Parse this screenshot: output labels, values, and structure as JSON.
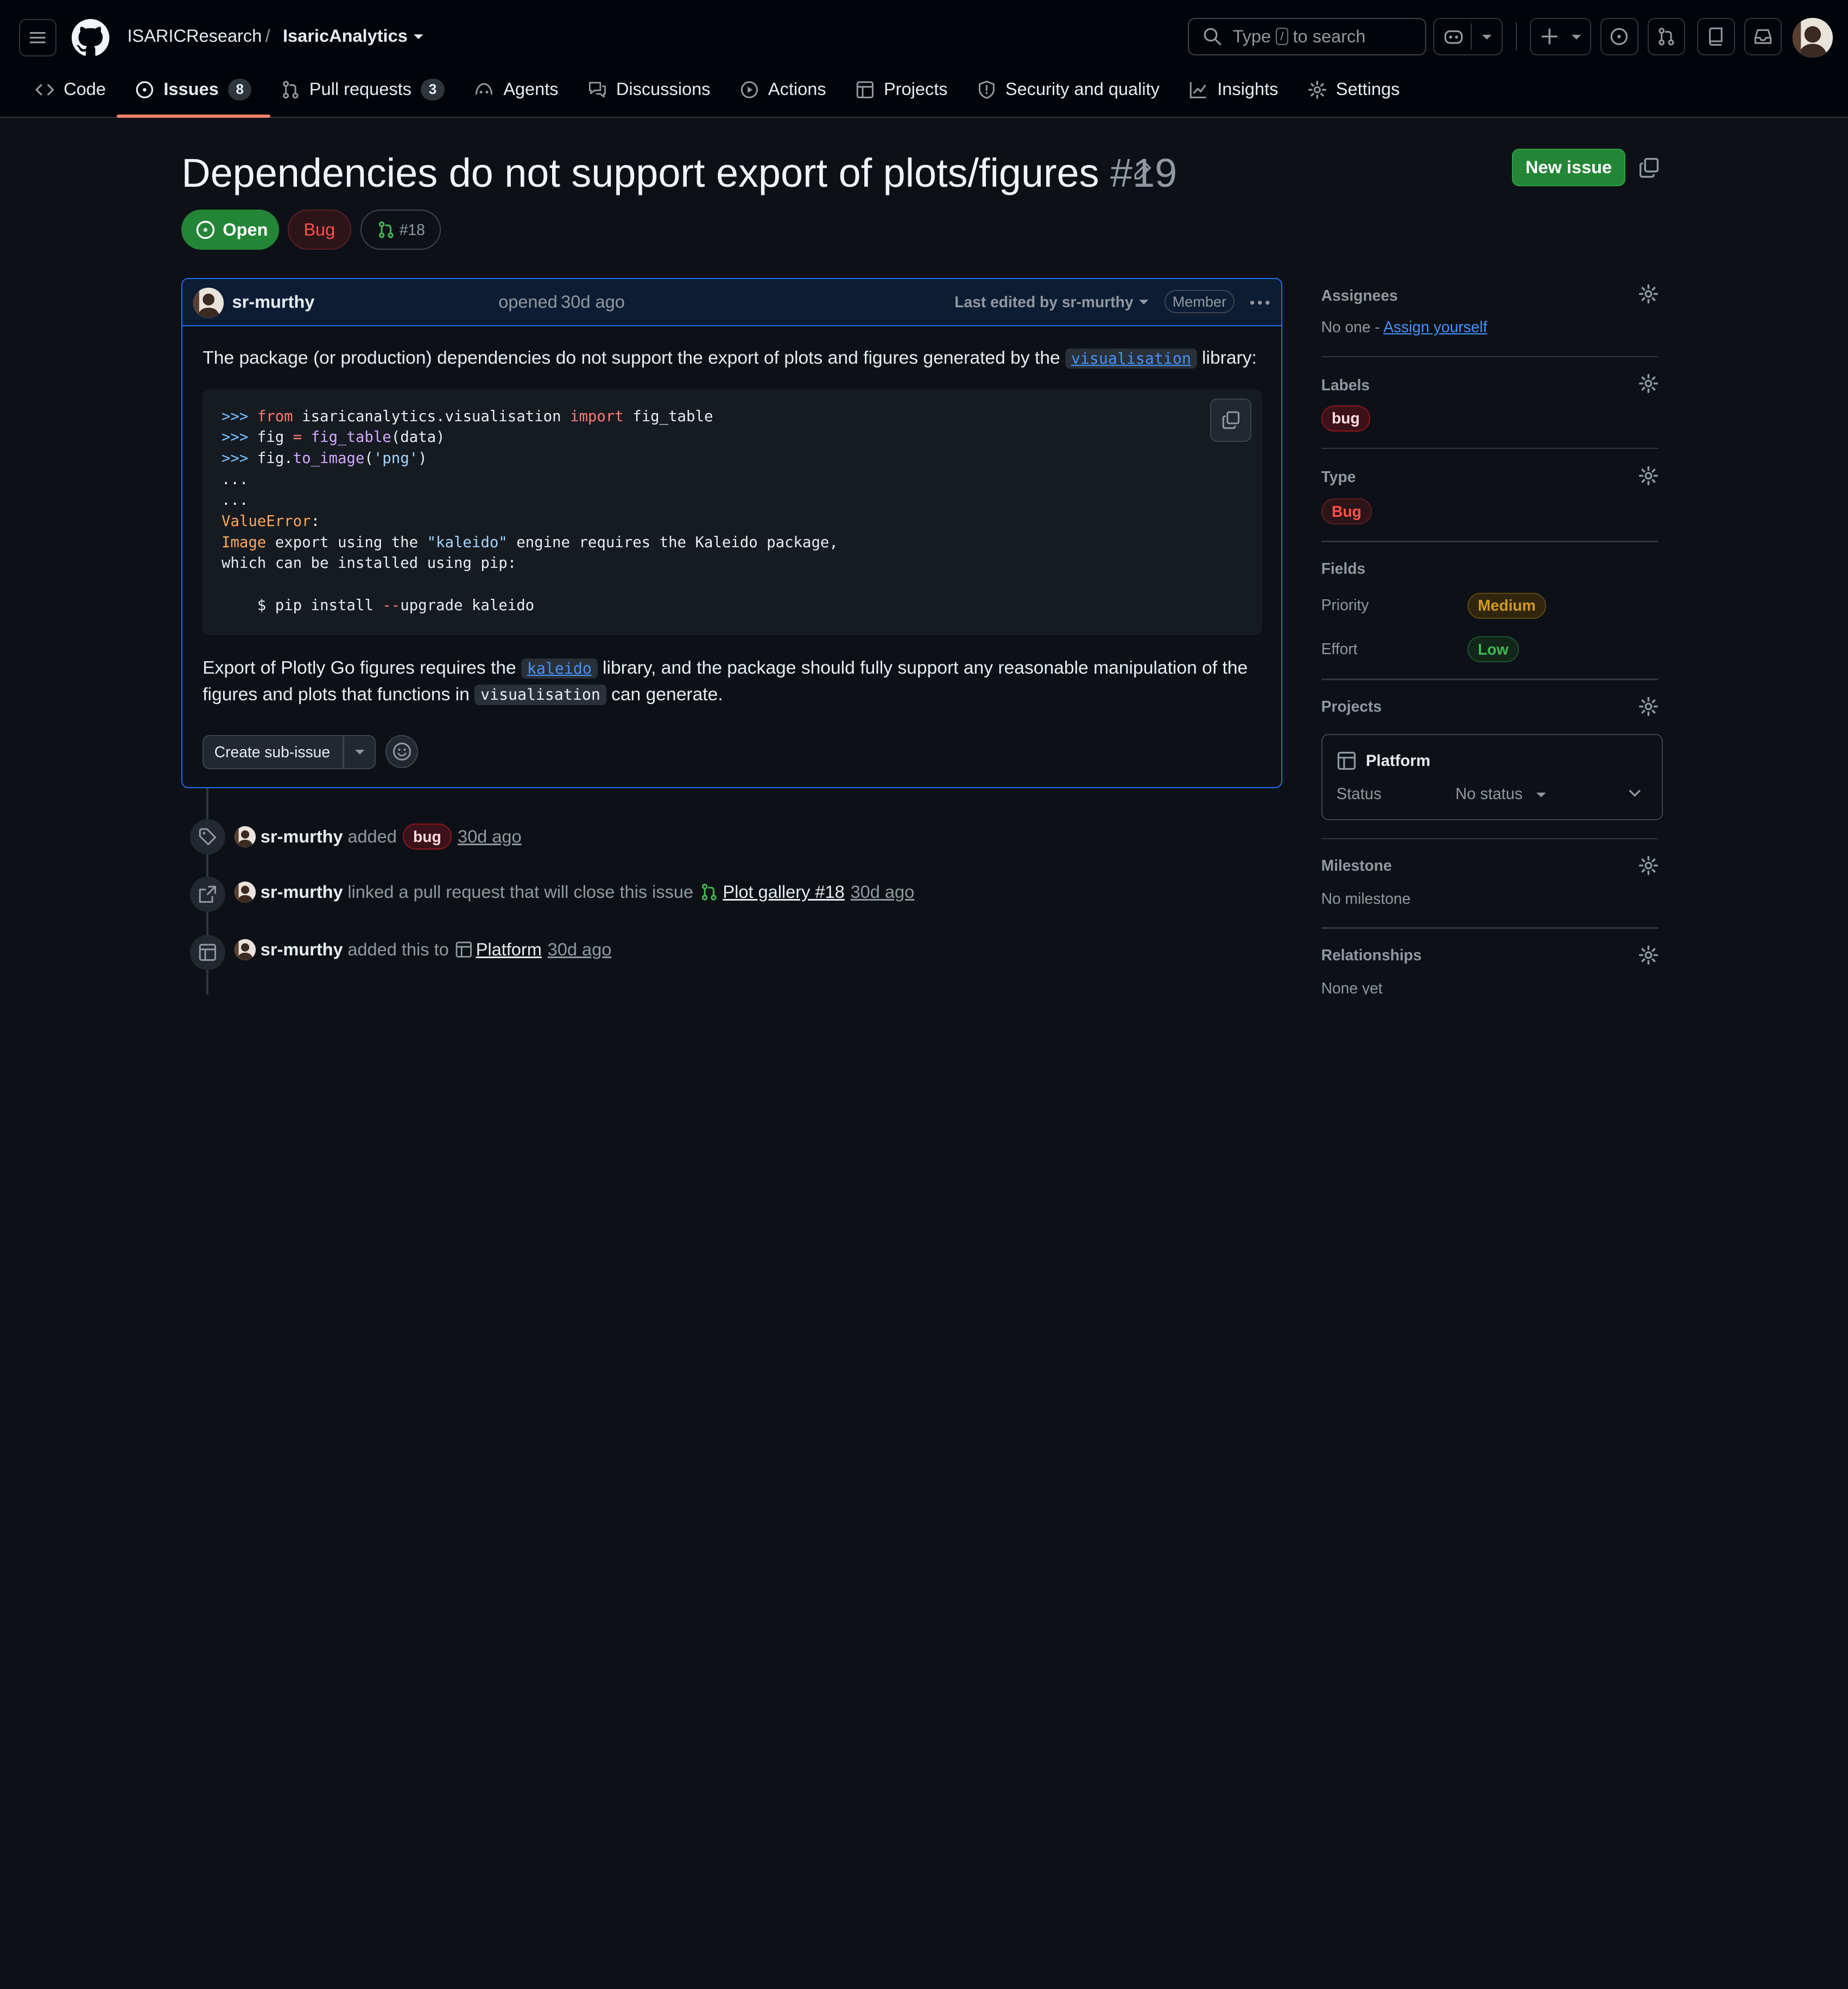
{
  "header": {
    "owner": "ISARICResearch",
    "separator": "/",
    "repo": "IsaricAnalytics",
    "search_prefix": "Type",
    "search_key": "/",
    "search_suffix": "to search"
  },
  "tabs": [
    {
      "label": "Code"
    },
    {
      "label": "Issues",
      "count": "8"
    },
    {
      "label": "Pull requests",
      "count": "3"
    },
    {
      "label": "Agents"
    },
    {
      "label": "Discussions"
    },
    {
      "label": "Actions"
    },
    {
      "label": "Projects"
    },
    {
      "label": "Security and quality"
    },
    {
      "label": "Insights"
    },
    {
      "label": "Settings"
    }
  ],
  "issue": {
    "title": "Dependencies do not support export of plots/figures",
    "number": "#19",
    "new_issue_label": "New issue",
    "state": "Open",
    "type_badge": "Bug",
    "linked_pr": "#18"
  },
  "comment": {
    "author": "sr-murthy",
    "opened": "opened",
    "time": "30d ago",
    "edited": "Last edited by sr-murthy",
    "role": "Member",
    "p1_before": "The package (or production) dependencies do not support the export of plots and figures generated by the",
    "p1_code": "visualisation",
    "p1_after": "library:",
    "code_lines": [
      ">>> from isaricanalytics.visualisation import fig_table",
      ">>> fig = fig_table(data)",
      ">>> fig.to_image('png')",
      "...",
      "...",
      "ValueError:",
      "Image export using the \"kaleido\" engine requires the Kaleido package,",
      "which can be installed using pip:",
      "",
      "    $ pip install --upgrade kaleido"
    ],
    "p2_before": "Export of Plotly Go figures requires the",
    "p2_code": "kaleido",
    "p2_mid": "library, and the package should fully support any reasonable manipulation of the",
    "p2_line2_before": "figures and plots that functions in",
    "p2_code2": "visualisation",
    "p2_after": "can generate.",
    "sub_issue_label": "Create sub-issue"
  },
  "timeline": [
    {
      "actor": "sr-murthy",
      "action": "added",
      "label": "bug",
      "time": "30d ago"
    },
    {
      "actor": "sr-murthy",
      "action": "linked a pull request that will close this issue",
      "link": "Plot gallery #18",
      "time": "30d ago"
    },
    {
      "actor": "sr-murthy",
      "action": "added this to",
      "link": "Platform",
      "time": "30d ago"
    }
  ],
  "sidebar": {
    "assignees_h": "Assignees",
    "assignees_none": "No one -",
    "assign_yourself": "Assign yourself",
    "labels_h": "Labels",
    "label": "bug",
    "type_h": "Type",
    "type": "Bug",
    "fields_h": "Fields",
    "priority_k": "Priority",
    "priority_v": "Medium",
    "effort_k": "Effort",
    "effort_v": "Low",
    "projects_h": "Projects",
    "project_name": "Platform",
    "status_k": "Status",
    "status_v": "No status",
    "milestone_h": "Milestone",
    "milestone_v": "No milestone",
    "relationships_h": "Relationships",
    "relationships_v": "None yet"
  },
  "colors": {
    "accent_green": "#238636",
    "open_green": "#238636",
    "bug_red": "#f85149",
    "medium_yellow": "#d29922",
    "low_green": "#3fb950",
    "link_blue": "#4493f8",
    "tab_underline": "#f78166"
  }
}
